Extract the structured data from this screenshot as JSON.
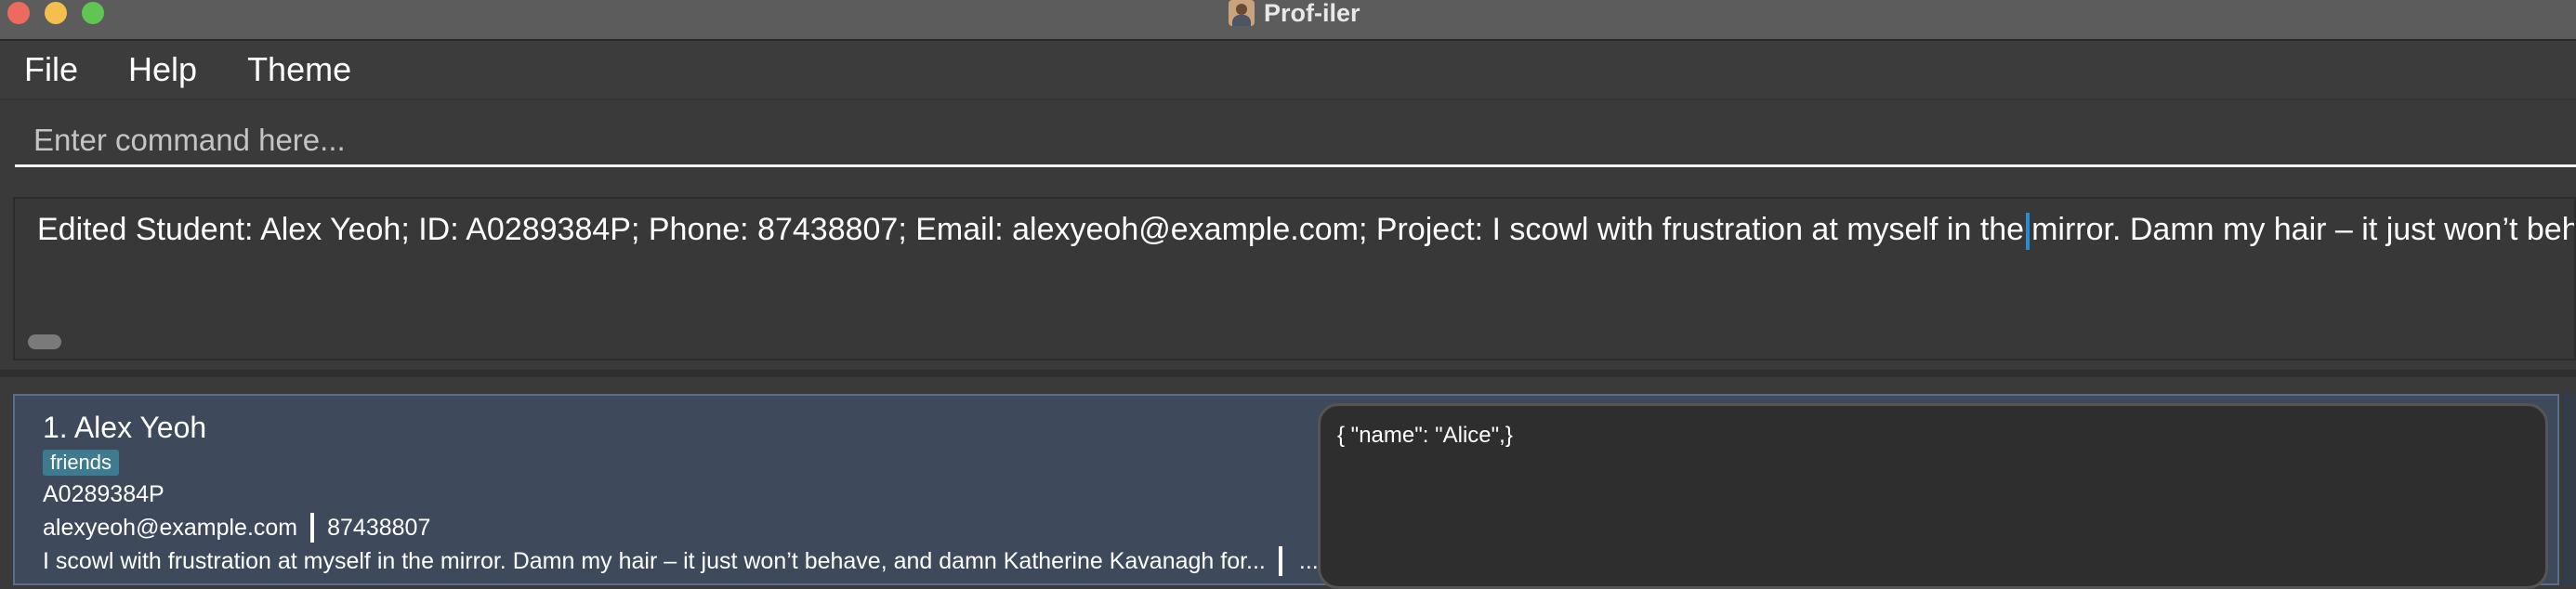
{
  "window": {
    "title": "Prof-iler",
    "app_icon": "student-avatar-icon"
  },
  "menu": {
    "items": [
      "File",
      "Help",
      "Theme"
    ]
  },
  "command": {
    "placeholder": "Enter command here...",
    "value": ""
  },
  "result": {
    "text_before_caret": "Edited Student: Alex Yeoh; ID: A0289384P; Phone: 87438807; Email: alexyeoh@example.com; Project: I scowl with frustration at myself in the",
    "text_after_caret": "mirror. Damn my hair – it just won’t behave, and"
  },
  "people": [
    {
      "index_name": "1. Alex Yeoh",
      "tags": [
        "friends"
      ],
      "student_id": "A0289384P",
      "email": "alexyeoh@example.com",
      "phone": "87438807",
      "project": "I scowl with frustration at myself in the mirror. Damn my hair – it just won’t behave, and damn Katherine Kavanagh for...",
      "more_label": "...",
      "json_preview": "{  \"name\": \"Alice\",}"
    }
  ],
  "colors": {
    "card_background": "#3e4a5c",
    "tag_background": "#3e7b91",
    "caret": "#2b8bd1",
    "traffic_close": "#ed6a5e",
    "traffic_minimize": "#f5bf4f",
    "traffic_maximize": "#61c554"
  }
}
